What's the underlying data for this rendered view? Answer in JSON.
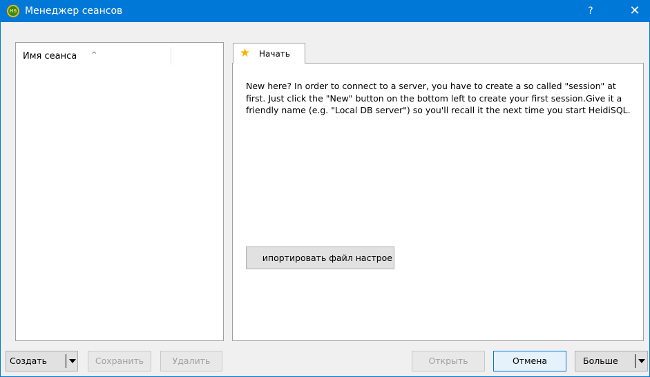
{
  "window": {
    "title": "Менеджер сеансов",
    "app_icon_text": "HS",
    "help_glyph": "?",
    "close_glyph": "✕"
  },
  "sessions": {
    "column_header": "Имя сеанса",
    "sort_glyph": "^",
    "items": []
  },
  "tabs": [
    {
      "label": "Начать",
      "icon": "star-icon",
      "icon_glyph": "★",
      "icon_color": "#f4b400"
    }
  ],
  "start_page": {
    "help_text": "New here? In order to connect to a server, you have to create a so called \"session\" at first. Just click the \"New\" button on the bottom left to create your first session.Give it a friendly name (e.g. \"Local DB server\") so you'll recall it the next time you start HeidiSQL.",
    "import_button_label": "ипортировать файл настрое"
  },
  "buttons": {
    "create": "Создать",
    "save": "Сохранить",
    "delete": "Удалить",
    "open": "Открыть",
    "cancel": "Отмена",
    "more": "Больше"
  },
  "colors": {
    "titlebar": "#0078d7",
    "accent_border": "#0078d7"
  }
}
